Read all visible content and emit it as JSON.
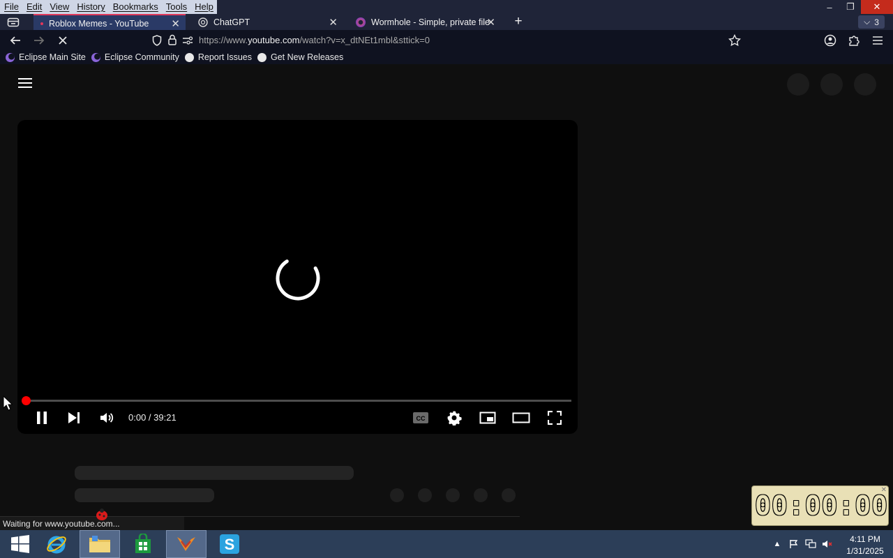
{
  "menubar": {
    "items": [
      "File",
      "Edit",
      "View",
      "History",
      "Bookmarks",
      "Tools",
      "Help"
    ]
  },
  "window_controls": {
    "minimize": "–",
    "restore": "❐",
    "close": "✕"
  },
  "tabs": [
    {
      "title": "Roblox Memes - YouTube",
      "active": true
    },
    {
      "title": "ChatGPT",
      "active": false
    },
    {
      "title": "Wormhole - Simple, private file",
      "active": false
    }
  ],
  "tab_count": "3",
  "nav": {
    "url_prefix": "https://www.",
    "url_host": "youtube.com",
    "url_path": "/watch?v=x_dtNEt1mbl&sttick=0"
  },
  "bookmarks": [
    {
      "label": "Eclipse Main Site",
      "icon": "eclipse-icon"
    },
    {
      "label": "Eclipse Community",
      "icon": "eclipse-icon"
    },
    {
      "label": "Report Issues",
      "icon": "github-icon"
    },
    {
      "label": "Get New Releases",
      "icon": "github-icon"
    }
  ],
  "player": {
    "current_time": "0:00",
    "duration": "39:21",
    "time_display": "0:00 / 39:21",
    "progress_fraction": 0.0,
    "state": "loading"
  },
  "status_text": "Waiting for www.youtube.com...",
  "clock_widget": {
    "display": "00:00:00"
  },
  "taskbar": {
    "apps": [
      "windows-start",
      "internet-explorer",
      "file-explorer",
      "store",
      "firefox",
      "skype"
    ],
    "active_app": "firefox",
    "time": "4:11 PM",
    "date": "1/31/2025"
  },
  "colors": {
    "accent_red": "#ff0000",
    "tab_active_bg": "#2a3a66",
    "taskbar_bg": "#2c3e58"
  }
}
